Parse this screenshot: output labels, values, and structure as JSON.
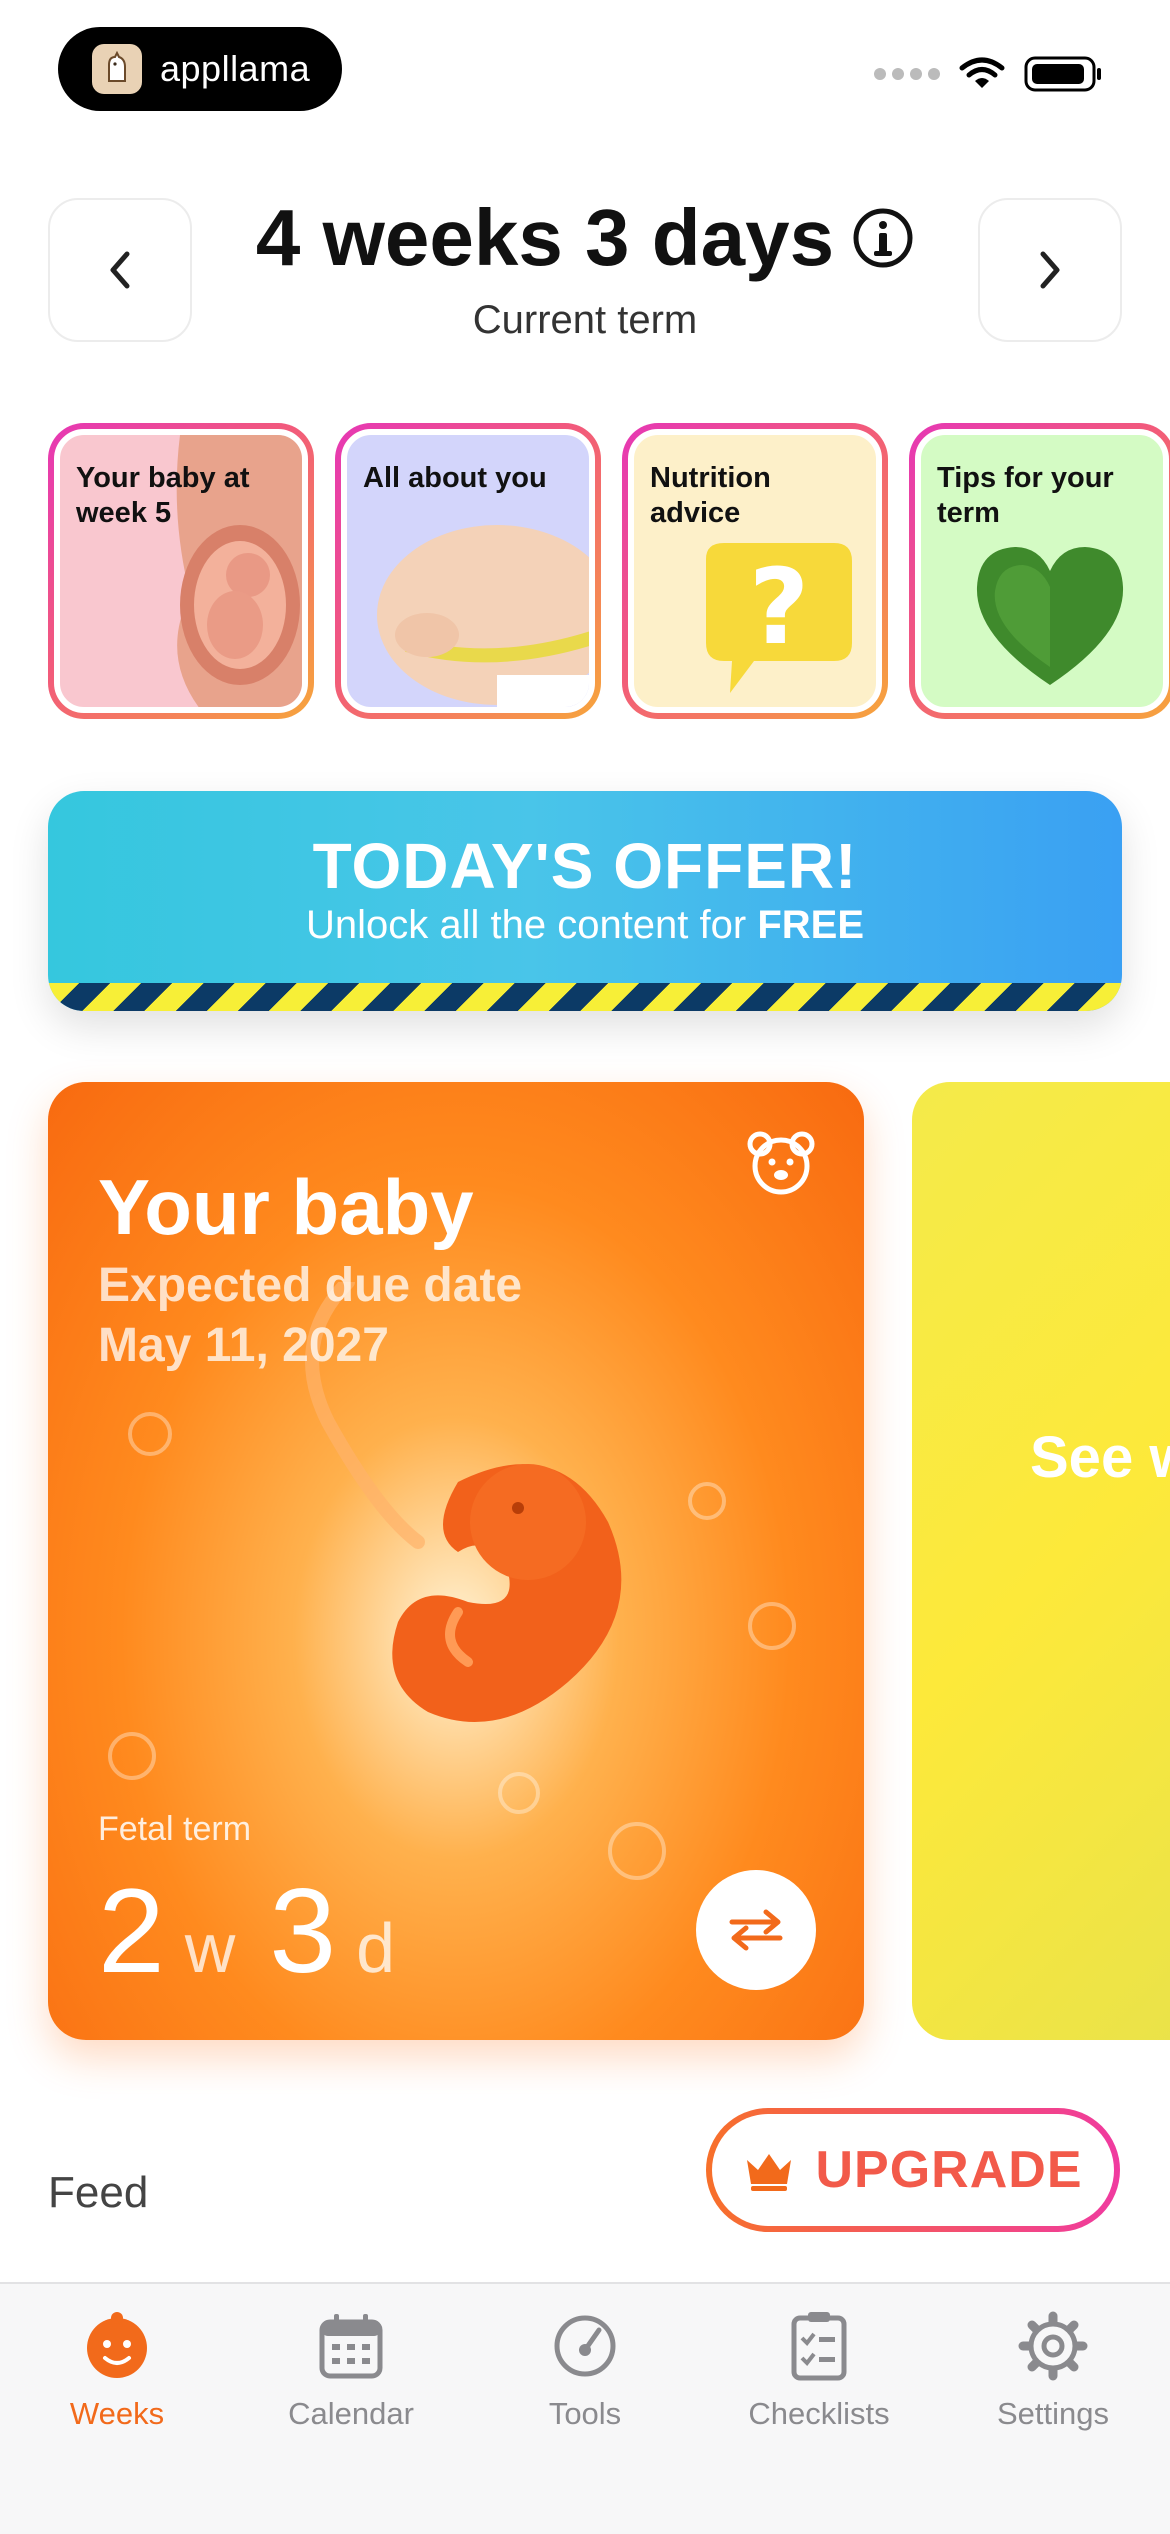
{
  "status_bar": {
    "app_name": "appllama"
  },
  "header": {
    "title": "4 weeks 3 days",
    "subtitle": "Current term",
    "prev_icon": "chevron-left-icon",
    "next_icon": "chevron-right-icon",
    "info_icon": "info-icon"
  },
  "stories": [
    {
      "label": "Your baby at week 5"
    },
    {
      "label": "All about you"
    },
    {
      "label": "Nutrition advice"
    },
    {
      "label": "Tips for your term"
    }
  ],
  "offer": {
    "title": "TODAY'S OFFER!",
    "subtitle_prefix": "Unlock all the content for",
    "subtitle_bold": "FREE"
  },
  "baby_card": {
    "title": "Your baby",
    "due_label": "Expected due date",
    "due_date": "May 11, 2027",
    "term_label": "Fetal term",
    "weeks": "2",
    "weeks_unit": "w",
    "days": "3",
    "days_unit": "d",
    "icon": "bear-icon"
  },
  "next_card": {
    "label": "See w"
  },
  "feed": {
    "label": "Feed"
  },
  "upgrade": {
    "label": "UPGRADE",
    "icon": "crown-icon"
  },
  "tabs": [
    {
      "label": "Weeks",
      "icon": "baby-face-icon",
      "active": true
    },
    {
      "label": "Calendar",
      "icon": "calendar-icon",
      "active": false
    },
    {
      "label": "Tools",
      "icon": "gauge-icon",
      "active": false
    },
    {
      "label": "Checklists",
      "icon": "checklist-icon",
      "active": false
    },
    {
      "label": "Settings",
      "icon": "gear-icon",
      "active": false
    }
  ],
  "colors": {
    "accent": "#f26a1b",
    "tab_inactive": "#8a8a8e",
    "offer_blue": "#3aa0f3",
    "baby_orange": "#ff8a1e"
  }
}
